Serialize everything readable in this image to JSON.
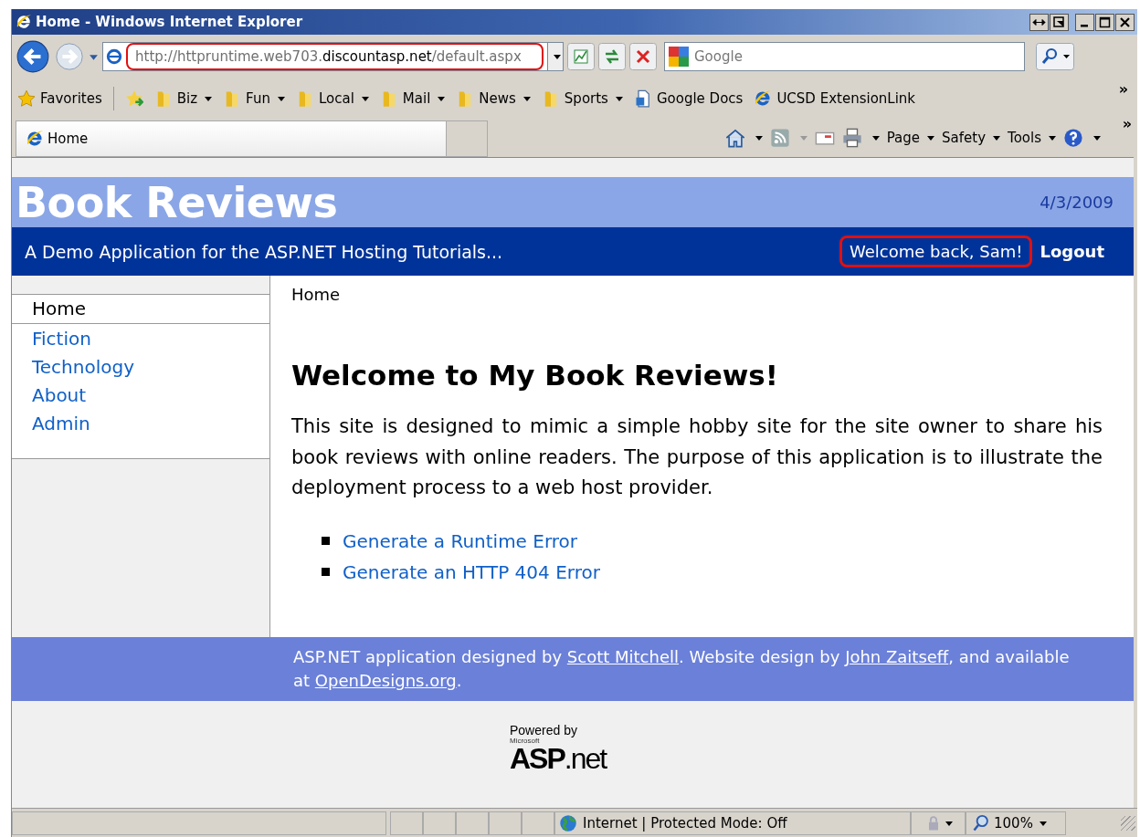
{
  "window": {
    "title": "Home - Windows Internet Explorer"
  },
  "address": {
    "prefix": "http://httpruntime.web703.",
    "domain": "discountasp.net",
    "path": "/default.aspx",
    "highlighted": true
  },
  "search": {
    "placeholder": "Google"
  },
  "favorites": {
    "label": "Favorites",
    "items": [
      {
        "label": "Biz",
        "kind": "folder"
      },
      {
        "label": "Fun",
        "kind": "folder"
      },
      {
        "label": "Local",
        "kind": "folder"
      },
      {
        "label": "Mail",
        "kind": "folder"
      },
      {
        "label": "News",
        "kind": "folder"
      },
      {
        "label": "Sports",
        "kind": "folder"
      },
      {
        "label": "Google Docs",
        "kind": "page"
      },
      {
        "label": "UCSD ExtensionLink",
        "kind": "ie"
      }
    ],
    "more": "»"
  },
  "tab": {
    "label": "Home"
  },
  "command_bar": {
    "items": [
      "Page",
      "Safety",
      "Tools"
    ],
    "more": "»"
  },
  "page": {
    "site_title": "Book Reviews",
    "date": "4/3/2009",
    "tagline": "A Demo Application for the ASP.NET Hosting Tutorials...",
    "welcome": {
      "text": "Welcome back, Sam!",
      "highlighted": true
    },
    "logout": "Logout",
    "menu": [
      {
        "label": "Home",
        "selected": true
      },
      {
        "label": "Fiction",
        "selected": false
      },
      {
        "label": "Technology",
        "selected": false
      },
      {
        "label": "About",
        "selected": false
      },
      {
        "label": "Admin",
        "selected": false
      }
    ],
    "breadcrumb": "Home",
    "heading": "Welcome to My Book Reviews!",
    "paragraph": "This site is designed to mimic a simple hobby site for the site owner to share his book reviews with online readers. The purpose of this application is to illustrate the deployment process to a web host provider.",
    "links": [
      "Generate a Runtime Error",
      "Generate an HTTP 404 Error"
    ],
    "footer": [
      {
        "text": "ASP.NET application designed by ",
        "link": false
      },
      {
        "text": "Scott Mitchell",
        "link": true
      },
      {
        "text": ". Website design by ",
        "link": false
      },
      {
        "text": "John Zaitseff",
        "link": true
      },
      {
        "text": ", and available at ",
        "link": false
      },
      {
        "text": "OpenDesigns.org",
        "link": true
      },
      {
        "text": ".",
        "link": false
      }
    ],
    "powered_by": {
      "label": "Powered by",
      "maker": "Microsoft",
      "logo": "ASP",
      "logo_suffix": ".net"
    }
  },
  "status_bar": {
    "zone": "Internet | Protected Mode: Off",
    "zoom": "100%"
  }
}
